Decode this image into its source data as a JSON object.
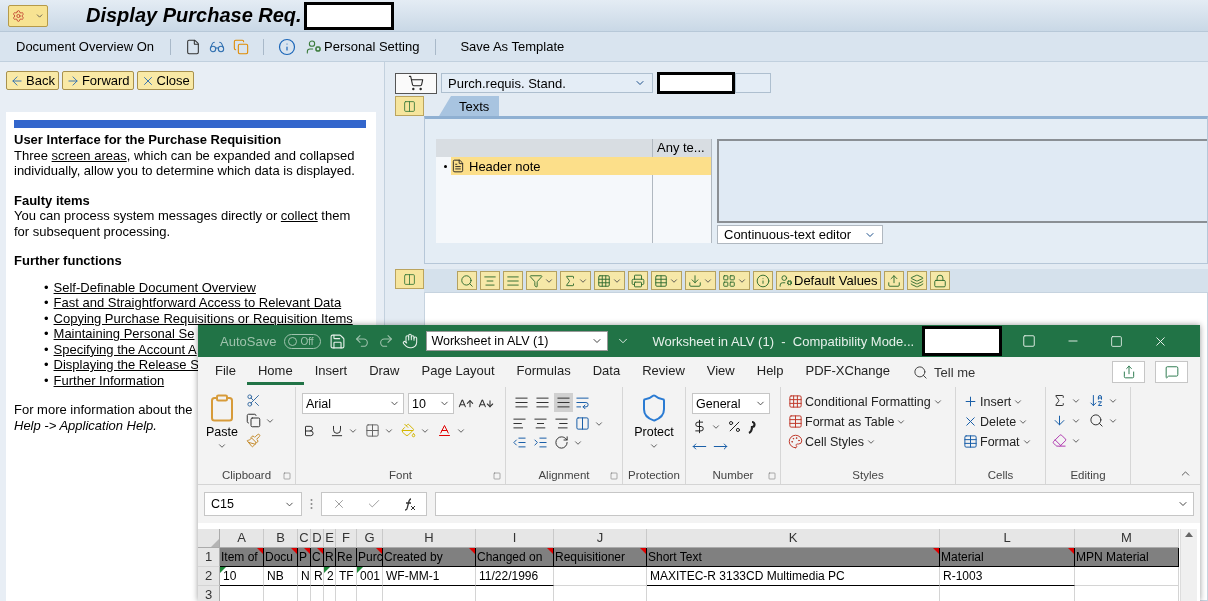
{
  "sap": {
    "title": "Display Purchase Req.",
    "toolbar": {
      "overview": "Document Overview On",
      "personal_setting": "Personal Setting",
      "template": "Save As Template"
    },
    "nav_buttons": [
      {
        "label": "Back",
        "kind": "back"
      },
      {
        "label": "Forward",
        "kind": "forward"
      },
      {
        "label": "Close",
        "kind": "close"
      }
    ],
    "help": {
      "title": "User Interface for the Purchase Requisition",
      "intro": {
        "before": "Three ",
        "link": "screen areas",
        "after": ", which can be expanded and collapsed individually, allow you to determine which data is displayed."
      },
      "faulty_title": "Faulty items",
      "faulty": {
        "before": "You can process system messages directly or ",
        "link": "collect",
        "after": " them for subsequent processing."
      },
      "further_title": "Further functions",
      "links": [
        {
          "marker": "•",
          "label": "Self-Definable Document Overview"
        },
        {
          "marker": "•",
          "label": "Fast and Straightforward Access to Relevant Data"
        },
        {
          "marker": "•",
          "label": "Copying Purchase Requisitions or Requisition Items"
        },
        {
          "marker": "•",
          "label": "Maintaining Personal Se"
        },
        {
          "marker": "•",
          "label": "Specifying the Account A"
        },
        {
          "marker": "•",
          "label": "Displaying the Release S"
        },
        {
          "marker": "•",
          "label": "Further Information"
        }
      ],
      "more": "For more information about the",
      "more_path": "Help -> Application Help."
    },
    "doc_type": "Purch.requis. Stand.",
    "tabs": [
      {
        "label": "Texts",
        "selected": true
      }
    ],
    "texts_table": {
      "column_2": "Any te...",
      "rows": [
        {
          "label": "Header note",
          "selected": true
        }
      ]
    },
    "editor_mode": "Continuous-text editor",
    "default_values": "Default Values"
  },
  "excel": {
    "autosave": {
      "label": "AutoSave",
      "state": "Off",
      "on": false
    },
    "file": "Worksheet in ALV (1)",
    "title": "Worksheet in ALV (1)  -  Compatibility Mode...",
    "tabs": [
      {
        "label": "File",
        "selected": false
      },
      {
        "label": "Home",
        "selected": true
      },
      {
        "label": "Insert",
        "selected": false
      },
      {
        "label": "Draw",
        "selected": false
      },
      {
        "label": "Page Layout",
        "selected": false
      },
      {
        "label": "Formulas",
        "selected": false
      },
      {
        "label": "Data",
        "selected": false
      },
      {
        "label": "Review",
        "selected": false
      },
      {
        "label": "View",
        "selected": false
      },
      {
        "label": "Help",
        "selected": false
      },
      {
        "label": "PDF-XChange",
        "selected": false
      }
    ],
    "tell_me": "Tell me",
    "ribbon": {
      "paste": "Paste",
      "font": "Arial",
      "size": "10",
      "vertical_align": [
        {
          "selected": false
        },
        {
          "selected": false
        },
        {
          "selected": true
        }
      ],
      "protect": "Protect",
      "number_format": "General",
      "styles": [
        "Conditional Formatting",
        "Format as Table",
        "Cell Styles"
      ],
      "cells": [
        "Insert",
        "Delete",
        "Format"
      ],
      "groups": [
        "Clipboard",
        "Font",
        "Alignment",
        "Protection",
        "Number",
        "Styles",
        "Cells",
        "Editing"
      ]
    },
    "name_box": "C15",
    "columns": [
      "A",
      "B",
      "C",
      "D",
      "E",
      "F",
      "G",
      "H",
      "I",
      "J",
      "K",
      "L",
      "M"
    ],
    "rows": [
      {
        "number": "1",
        "kind": "header",
        "cells": [
          {
            "text": "Item of",
            "note": true
          },
          {
            "text": "Docu",
            "note": true
          },
          {
            "text": "P",
            "note": true
          },
          {
            "text": "C",
            "note": true
          },
          {
            "text": "R",
            "note": false
          },
          {
            "text": "Re",
            "note": false
          },
          {
            "text": "Purc",
            "note": true
          },
          {
            "text": "Created by",
            "note": true
          },
          {
            "text": "Changed on",
            "note": true
          },
          {
            "text": "Requisitioner",
            "note": true
          },
          {
            "text": "Short Text",
            "note": true
          },
          {
            "text": "Material",
            "note": true
          },
          {
            "text": "MPN Material",
            "note": false
          }
        ]
      },
      {
        "number": "2",
        "kind": "data",
        "cells": [
          {
            "text": "10",
            "flag": true
          },
          {
            "text": "NB",
            "flag": false
          },
          {
            "text": "N",
            "flag": false
          },
          {
            "text": "R",
            "flag": false
          },
          {
            "text": "2",
            "flag": true
          },
          {
            "text": "TF",
            "flag": false
          },
          {
            "text": "001",
            "flag": true
          },
          {
            "text": "WF-MM-1",
            "flag": false
          },
          {
            "text": "11/22/1996",
            "flag": false
          },
          null,
          {
            "text": "MAXITEC-R 3133CD Multimedia PC",
            "flag": false
          },
          {
            "text": "R-1003",
            "flag": false
          },
          null
        ]
      },
      {
        "number": "3",
        "kind": "data"
      }
    ]
  }
}
